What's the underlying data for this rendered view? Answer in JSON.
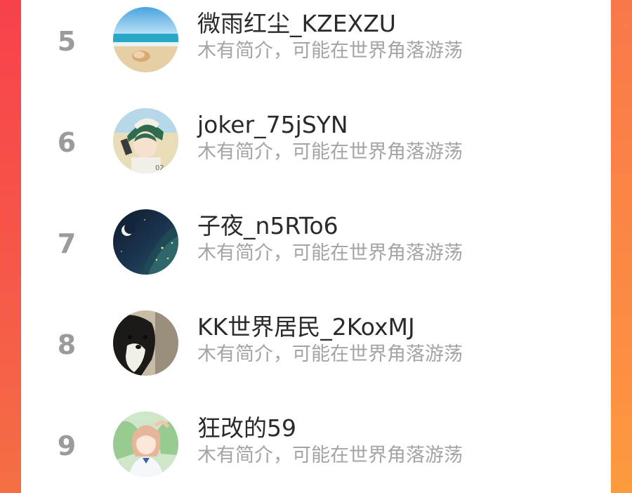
{
  "leaderboard": {
    "entries": [
      {
        "rank": "5",
        "name": "微雨红尘_KZEXZU",
        "bio": "木有简介，可能在世界角落游荡",
        "avatar": "beach-shell-avatar"
      },
      {
        "rank": "6",
        "name": "joker_75jSYN",
        "bio": "木有简介，可能在世界角落游荡",
        "avatar": "anime-boy-cap-avatar"
      },
      {
        "rank": "7",
        "name": "子夜_n5RTo6",
        "bio": "木有简介，可能在世界角落游荡",
        "avatar": "night-sky-avatar"
      },
      {
        "rank": "8",
        "name": "KK世界居民_2KoxMJ",
        "bio": "木有简介，可能在世界角落游荡",
        "avatar": "border-collie-avatar"
      },
      {
        "rank": "9",
        "name": "狂改的59",
        "bio": "木有简介，可能在世界角落游荡",
        "avatar": "anime-girl-avatar"
      }
    ]
  },
  "colors": {
    "frame_left": "#f6414b",
    "frame_right": "#fb8a44",
    "rank_text": "#9b9b9b",
    "name_text": "#2a2a2a",
    "bio_text": "#a4a4a4"
  }
}
